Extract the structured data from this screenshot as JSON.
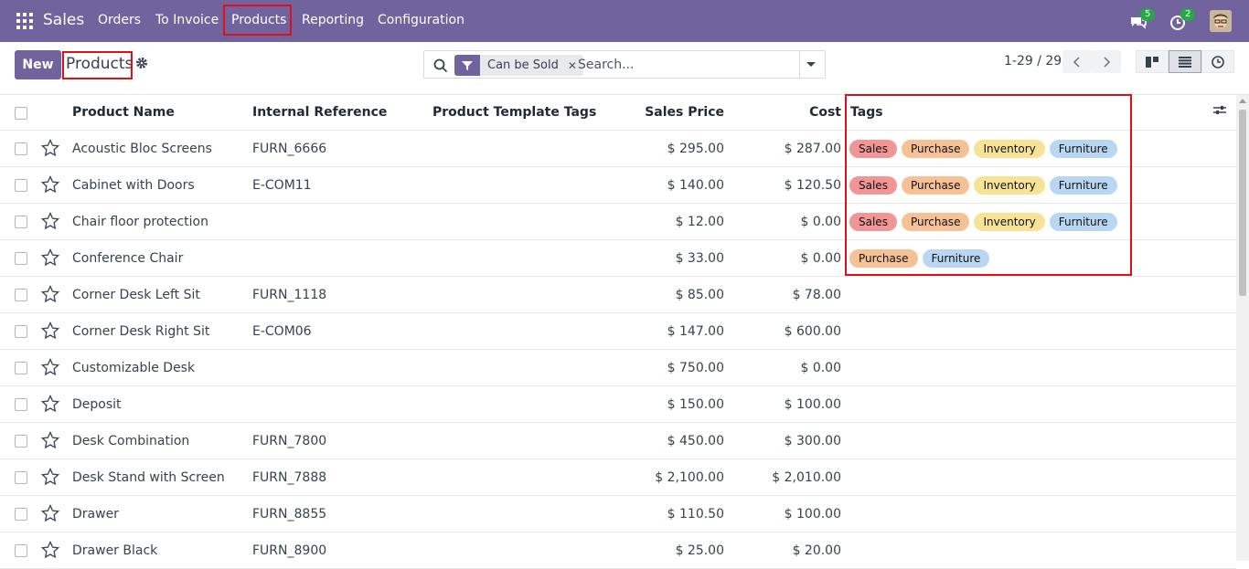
{
  "navbar": {
    "app_name": "Sales",
    "menu": [
      "Orders",
      "To Invoice",
      "Products",
      "Reporting",
      "Configuration"
    ],
    "active_menu": "Products",
    "messages_count": "5",
    "activities_count": "2",
    "icons": [
      "apps-grid-icon",
      "chat-icon",
      "clock-icon",
      "avatar"
    ]
  },
  "control_panel": {
    "new_label": "New",
    "title": "Products",
    "search": {
      "facet_value": "Can be Sold",
      "placeholder": "Search..."
    },
    "pager": "1-29 / 29"
  },
  "table": {
    "headers": {
      "name": "Product Name",
      "ref": "Internal Reference",
      "template_tags": "Product Template Tags",
      "price": "Sales Price",
      "cost": "Cost",
      "tags": "Tags"
    },
    "rows": [
      {
        "name": "Acoustic Bloc Screens",
        "ref": "FURN_6666",
        "price": "$ 295.00",
        "cost": "$ 287.00",
        "tags": [
          "Sales",
          "Purchase",
          "Inventory",
          "Furniture"
        ]
      },
      {
        "name": "Cabinet with Doors",
        "ref": "E-COM11",
        "price": "$ 140.00",
        "cost": "$ 120.50",
        "tags": [
          "Sales",
          "Purchase",
          "Inventory",
          "Furniture"
        ]
      },
      {
        "name": "Chair floor protection",
        "ref": "",
        "price": "$ 12.00",
        "cost": "$ 0.00",
        "tags": [
          "Sales",
          "Purchase",
          "Inventory",
          "Furniture"
        ]
      },
      {
        "name": "Conference Chair",
        "ref": "",
        "price": "$ 33.00",
        "cost": "$ 0.00",
        "tags": [
          "Purchase",
          "Furniture"
        ]
      },
      {
        "name": "Corner Desk Left Sit",
        "ref": "FURN_1118",
        "price": "$ 85.00",
        "cost": "$ 78.00",
        "tags": []
      },
      {
        "name": "Corner Desk Right Sit",
        "ref": "E-COM06",
        "price": "$ 147.00",
        "cost": "$ 600.00",
        "tags": []
      },
      {
        "name": "Customizable Desk",
        "ref": "",
        "price": "$ 750.00",
        "cost": "$ 0.00",
        "tags": []
      },
      {
        "name": "Deposit",
        "ref": "",
        "price": "$ 150.00",
        "cost": "$ 100.00",
        "tags": []
      },
      {
        "name": "Desk Combination",
        "ref": "FURN_7800",
        "price": "$ 450.00",
        "cost": "$ 300.00",
        "tags": []
      },
      {
        "name": "Desk Stand with Screen",
        "ref": "FURN_7888",
        "price": "$ 2,100.00",
        "cost": "$ 2,010.00",
        "tags": []
      },
      {
        "name": "Drawer",
        "ref": "FURN_8855",
        "price": "$ 110.50",
        "cost": "$ 100.00",
        "tags": []
      },
      {
        "name": "Drawer Black",
        "ref": "FURN_8900",
        "price": "$ 25.00",
        "cost": "$ 20.00",
        "tags": []
      }
    ]
  },
  "colors": {
    "brand": "#71639e",
    "tag_sales": "#f29595",
    "tag_purchase": "#f6c195",
    "tag_inventory": "#f7e396",
    "tag_furniture": "#b9d6f3",
    "highlight": "#e0101a"
  }
}
